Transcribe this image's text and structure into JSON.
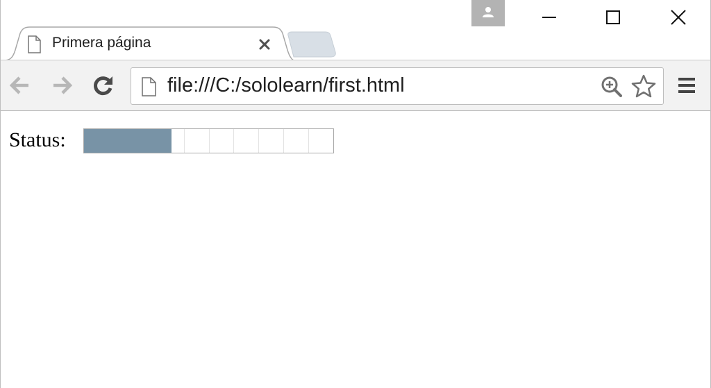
{
  "browser": {
    "tab": {
      "title": "Primera página",
      "page_icon": "page-icon",
      "close_icon": "close-icon"
    },
    "window_controls": {
      "profile_icon": "person-icon",
      "minimize_icon": "minimize-icon",
      "maximize_icon": "maximize-icon",
      "close_icon": "close-icon"
    },
    "toolbar": {
      "back_icon": "arrow-left-icon",
      "forward_icon": "arrow-right-icon",
      "reload_icon": "reload-icon",
      "url": "file:///C:/sololearn/first.html",
      "zoom_icon": "zoom-in-icon",
      "bookmark_icon": "star-icon",
      "menu_icon": "hamburger-menu-icon"
    }
  },
  "page": {
    "status_label": "Status:",
    "progress": {
      "value": 0.35,
      "segments": 10,
      "fill_color": "#7893a6"
    }
  }
}
